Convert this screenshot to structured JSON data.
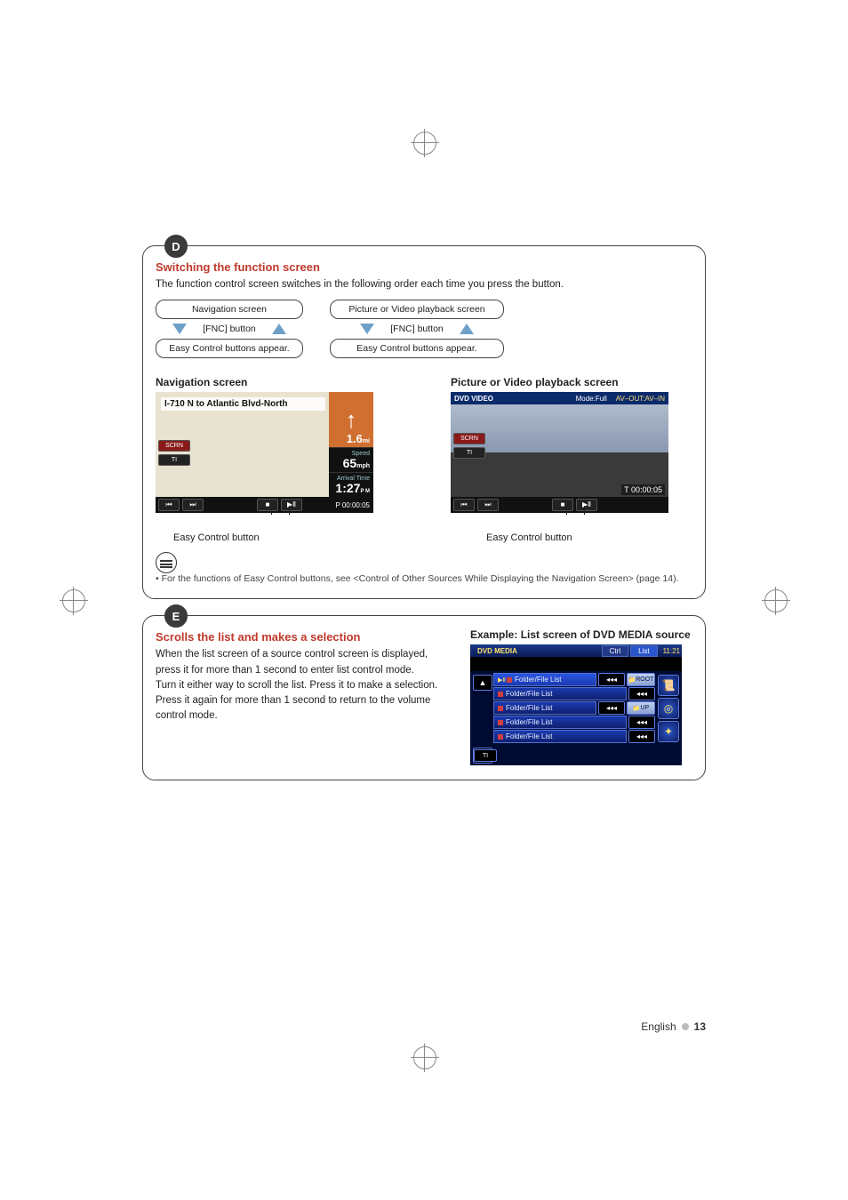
{
  "sectionD": {
    "letter": "D",
    "title": "Switching the function screen",
    "intro": "The function control screen switches in the following order each time you press the button.",
    "flow": {
      "left": {
        "top": "Navigation screen",
        "mid": "[FNC] button",
        "bottom": "Easy Control buttons appear."
      },
      "right": {
        "top": "Picture or Video playback screen",
        "mid": "[FNC] button",
        "bottom": "Easy Control buttons appear."
      }
    },
    "navHeading": "Navigation screen",
    "vidHeading": "Picture or Video playback screen",
    "nav": {
      "title": "I-710 N to Atlantic Blvd-North",
      "dist": "1.6",
      "distUnit": "mi",
      "speedLabel": "Speed",
      "speed": "65",
      "speedUnit": "mph",
      "arrLabel": "Arrival Time",
      "arr": "1:27",
      "arrUnit": "P M",
      "scrn": "SCRN",
      "ti": "TI",
      "ptime": "P 00:00:05"
    },
    "vid": {
      "title": "DVD VIDEO",
      "mode": "Mode:Full",
      "avout": "AV–OUT:AV–IN",
      "scrn": "SCRN",
      "ti": "TI",
      "time": "T 00:00:05"
    },
    "easyLabel": "Easy Control button",
    "note": "For the functions of Easy Control buttons, see <Control of Other Sources While Displaying the Navigation Screen> (page 14)."
  },
  "sectionE": {
    "letter": "E",
    "title": "Scrolls the list and makes a selection",
    "body": "When the list screen of a source control screen is displayed, press it for more than 1 second to enter list control mode.\nTurn it either way to scroll the list. Press it to make a selection.\nPress it again for more than 1 second to return to the volume control mode.",
    "exampleHeading": "Example: List screen of DVD MEDIA source",
    "ls": {
      "title": "DVD MEDIA",
      "tabCtrl": "Ctrl",
      "tabList": "List",
      "time": "11:21",
      "item": "Folder/File List",
      "root": "ROOT",
      "up": "UP",
      "rew": "◂◂◂",
      "ti": "TI"
    }
  },
  "footer": {
    "lang": "English",
    "page": "13"
  }
}
